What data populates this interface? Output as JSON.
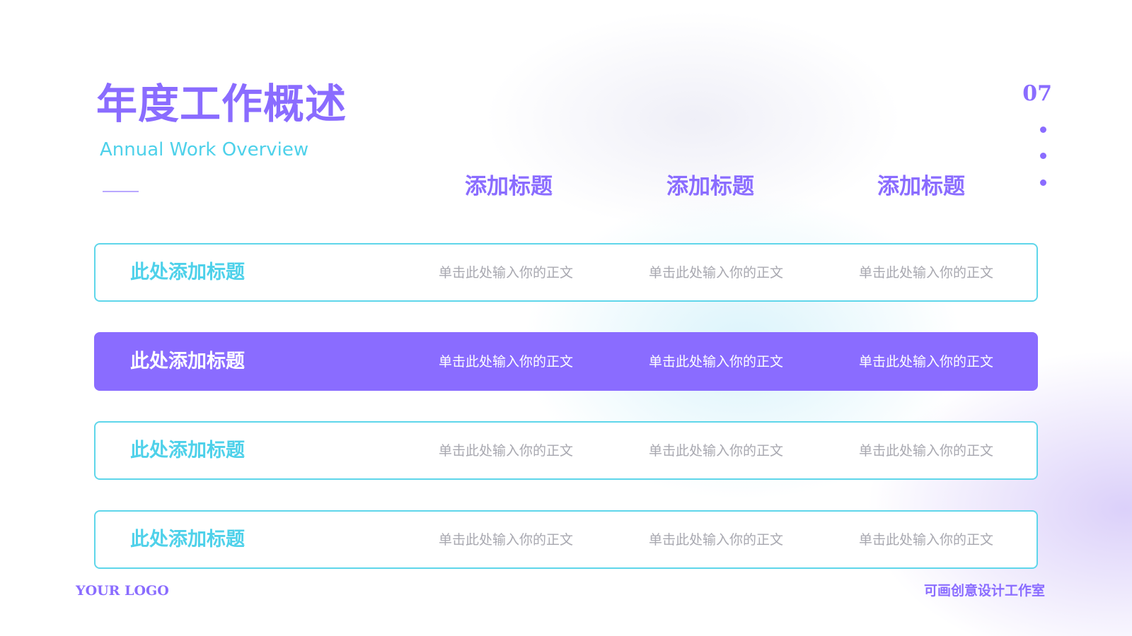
{
  "slide": {
    "title": "年度工作概述",
    "subtitle": "Annual Work Overview",
    "page_number": "07",
    "logo": "YOUR LOGO",
    "studio": "可画创意设计工作室"
  },
  "table": {
    "headers": [
      "添加标题",
      "添加标题",
      "添加标题"
    ],
    "rows": [
      {
        "title": "此处添加标题",
        "cells": [
          "单击此处输入你的正文",
          "单击此处输入你的正文",
          "单击此处输入你的正文"
        ],
        "highlighted": false
      },
      {
        "title": "此处添加标题",
        "cells": [
          "单击此处输入你的正文",
          "单击此处输入你的正文",
          "单击此处输入你的正文"
        ],
        "highlighted": true
      },
      {
        "title": "此处添加标题",
        "cells": [
          "单击此处输入你的正文",
          "单击此处输入你的正文",
          "单击此处输入你的正文"
        ],
        "highlighted": false
      },
      {
        "title": "此处添加标题",
        "cells": [
          "单击此处输入你的正文",
          "单击此处输入你的正文",
          "单击此处输入你的正文"
        ],
        "highlighted": false
      }
    ]
  },
  "colors": {
    "accent_purple": "#8a6cff",
    "accent_cyan": "#4ed1ea",
    "body_gray": "#a8a8b0",
    "background": "#ffffff"
  }
}
